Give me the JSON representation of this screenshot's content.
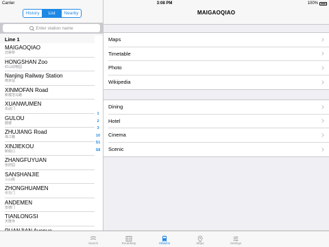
{
  "status_bar": {
    "carrier": "Carrier",
    "time": "3:08 PM",
    "battery": "100%"
  },
  "left": {
    "segments": [
      {
        "label": "History",
        "active": false
      },
      {
        "label": "List",
        "active": true
      },
      {
        "label": "Nearby",
        "active": false
      }
    ],
    "search_placeholder": "Enter station name",
    "section_title": "Line 1",
    "stations": [
      {
        "en": "MAIGAOQIAO",
        "cn": "迈皋桥"
      },
      {
        "en": "HONGSHAN Zoo",
        "cn": "红山动物园"
      },
      {
        "en": "Nanjing Railway Station",
        "cn": "南京站"
      },
      {
        "en": "XINMOFAN Road",
        "cn": "新模范马路"
      },
      {
        "en": "XUANWUMEN",
        "cn": "玄武门"
      },
      {
        "en": "GULOU",
        "cn": "鼓楼"
      },
      {
        "en": "ZHUJIANG Road",
        "cn": "珠江路"
      },
      {
        "en": "XINJIEKOU",
        "cn": "新街口"
      },
      {
        "en": "ZHANGFUYUAN",
        "cn": "张府园"
      },
      {
        "en": "SANSHANJIE",
        "cn": "三山街"
      },
      {
        "en": "ZHONGHUAMEN",
        "cn": "中华门"
      },
      {
        "en": "ANDEMEN",
        "cn": "安德门"
      },
      {
        "en": "TIANLONGSI",
        "cn": "天隆寺"
      },
      {
        "en": "RUANJIAN Avenue",
        "cn": ""
      }
    ],
    "index": [
      "1",
      "2",
      "3",
      "10",
      "S1",
      "S8"
    ]
  },
  "right": {
    "title": "MAIGAOQIAO",
    "group1": [
      "Maps",
      "Timetable",
      "Photo",
      "Wikipedia"
    ],
    "group2": [
      "Dining",
      "Hotel",
      "Cinema",
      "Scenic"
    ]
  },
  "tabs": [
    {
      "label": "Search",
      "icon": "search-tab-icon",
      "active": false
    },
    {
      "label": "RouteMap",
      "icon": "map-grid-icon",
      "active": false
    },
    {
      "label": "Stations",
      "icon": "train-icon",
      "active": true
    },
    {
      "label": "Maps",
      "icon": "location-pin-icon",
      "active": false
    },
    {
      "label": "Settings",
      "icon": "sliders-icon",
      "active": false
    }
  ],
  "colors": {
    "accent": "#1e88e5",
    "inactive": "#929292"
  }
}
